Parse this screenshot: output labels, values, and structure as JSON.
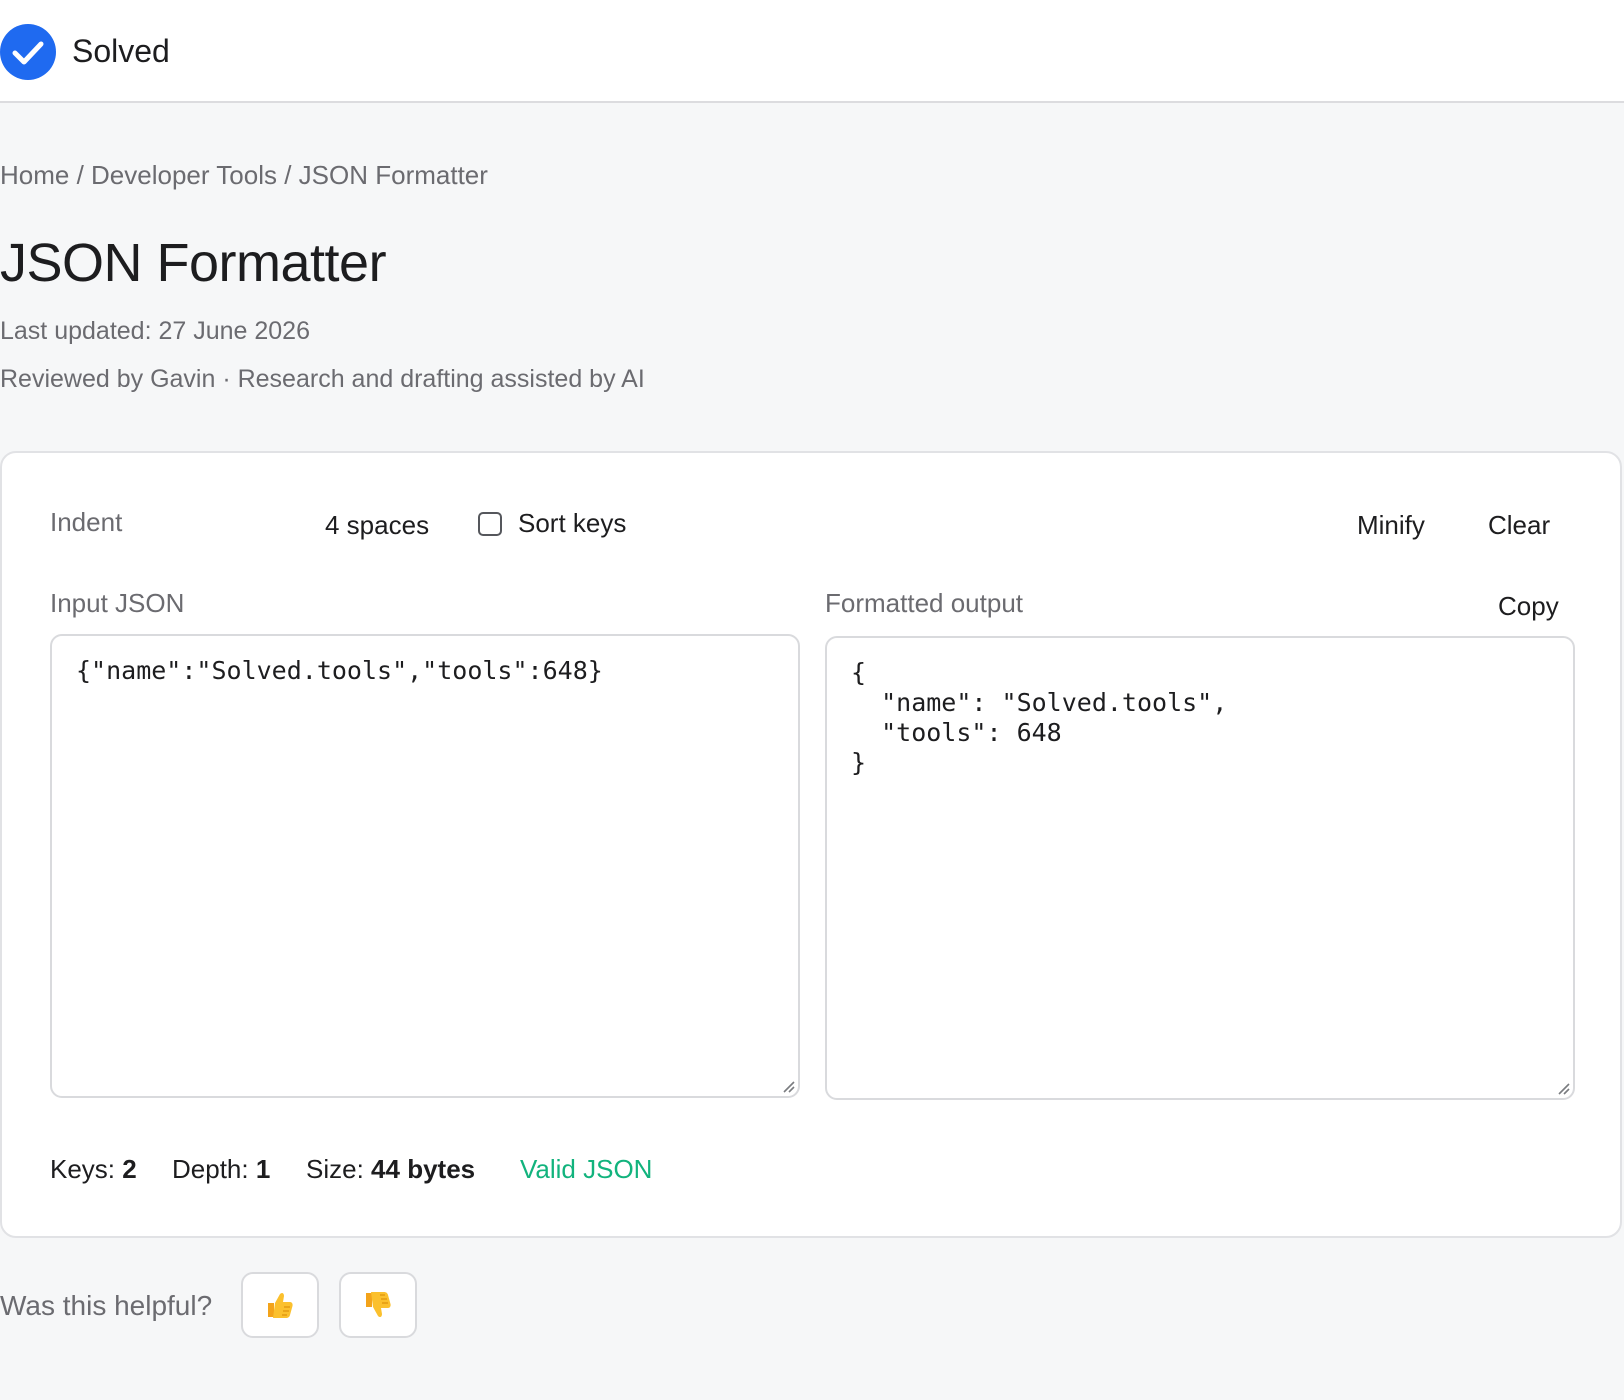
{
  "header": {
    "brand_name": "Solved",
    "brand_icon": "check-circle-icon",
    "brand_color": "#1f6af0"
  },
  "breadcrumb": {
    "items": [
      "Home",
      "Developer Tools",
      "JSON Formatter"
    ],
    "separator": " / "
  },
  "page": {
    "title": "JSON Formatter",
    "last_updated": "Last updated: 27 June 2026",
    "reviewed_by": "Reviewed by Gavin · Research and drafting assisted by AI"
  },
  "toolbar": {
    "indent_label": "Indent",
    "indent_value": "4 spaces",
    "sort_keys_label": "Sort keys",
    "sort_keys_checked": false,
    "minify_label": "Minify",
    "clear_label": "Clear"
  },
  "input": {
    "label": "Input JSON",
    "value": "{\"name\":\"Solved.tools\",\"tools\":648}"
  },
  "output": {
    "label": "Formatted output",
    "copy_label": "Copy",
    "value": "{\n  \"name\": \"Solved.tools\",\n  \"tools\": 648\n}"
  },
  "stats": {
    "keys_label": "Keys:",
    "keys_value": "2",
    "depth_label": "Depth:",
    "depth_value": "1",
    "size_label": "Size:",
    "size_value": "44 bytes",
    "status": "Valid JSON",
    "status_color": "#12b37d"
  },
  "feedback": {
    "question": "Was this helpful?",
    "thumbs_up_icon": "thumbs-up-icon",
    "thumbs_down_icon": "thumbs-down-icon"
  }
}
